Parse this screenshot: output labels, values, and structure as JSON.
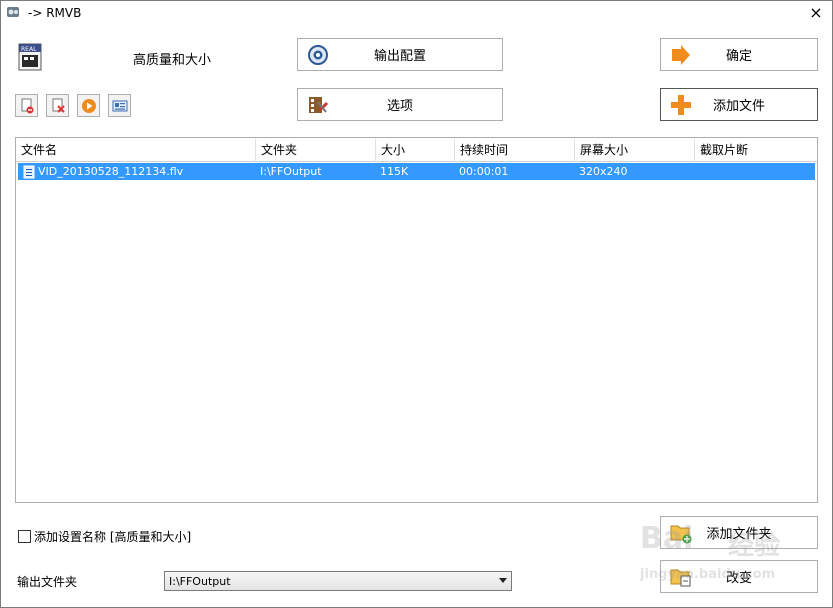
{
  "window": {
    "title": "-> RMVB",
    "close_glyph": "×"
  },
  "profile": {
    "name": "高质量和大小",
    "icon": "real-media-icon"
  },
  "buttons": {
    "output_config": "输出配置",
    "options": "选项",
    "ok": "确定",
    "add_file": "添加文件",
    "add_folder": "添加文件夹",
    "change": "改变"
  },
  "toolbar": {
    "remove": "remove-file-icon",
    "clear": "clear-list-icon",
    "play": "play-icon",
    "info": "media-info-icon"
  },
  "file_list": {
    "columns": [
      "文件名",
      "文件夹",
      "大小",
      "持续时间",
      "屏幕大小",
      "截取片断"
    ],
    "rows": [
      {
        "name": "VID_20130528_112134.flv",
        "folder": "I:\\FFOutput",
        "size": "115K",
        "duration": "00:00:01",
        "screen": "320x240",
        "clip": ""
      }
    ]
  },
  "checkbox": {
    "label": "添加设置名称 [高质量和大小]",
    "checked": false
  },
  "output": {
    "label": "输出文件夹",
    "value": "I:\\FFOutput"
  },
  "watermark": {
    "line1": "Bai",
    "line2": "经验",
    "line3": "jingyan.baidu.com"
  },
  "colors": {
    "selection": "#3399ff",
    "orange": "#f08c1e"
  }
}
